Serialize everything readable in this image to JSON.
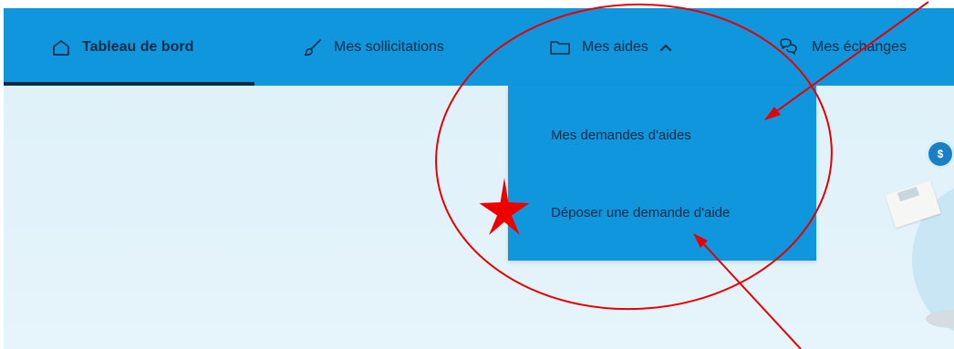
{
  "nav": {
    "items": [
      {
        "label": "Tableau de bord",
        "icon": "home-icon",
        "active": true
      },
      {
        "label": "Mes sollicitations",
        "icon": "brush-icon",
        "active": false
      },
      {
        "label": "Mes aides",
        "icon": "folder-icon",
        "active": false,
        "expanded": true
      },
      {
        "label": "Mes échanges",
        "icon": "chat-bubbles-icon",
        "active": false
      }
    ]
  },
  "dropdown": {
    "items": [
      {
        "label": "Mes demandes d'aides"
      },
      {
        "label": "Déposer une demande d'aide"
      }
    ]
  },
  "decor": {
    "coin_symbol": "$"
  },
  "colors": {
    "nav_background": "#0f96dc",
    "text_dark": "#0b2b46",
    "annotation_red": "#e60000",
    "content_background": "#dff1f9"
  }
}
